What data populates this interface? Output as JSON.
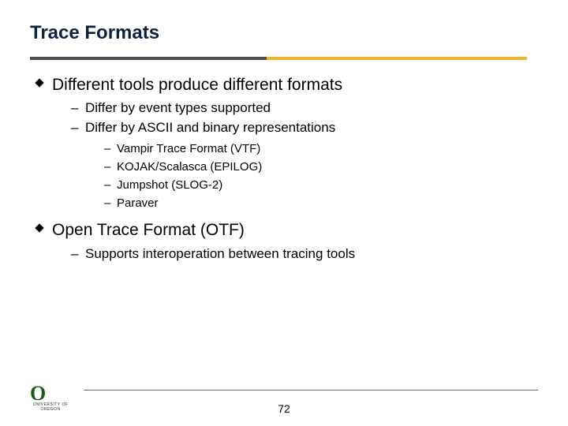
{
  "title": "Trace Formats",
  "bullets": [
    {
      "text": "Different tools produce different formats",
      "sub": [
        {
          "text": "Differ by event types supported"
        },
        {
          "text": "Differ by ASCII and binary representations",
          "sub": [
            {
              "text": "Vampir Trace Format (VTF)"
            },
            {
              "text": "KOJAK/Scalasca (EPILOG)"
            },
            {
              "text": "Jumpshot (SLOG-2)"
            },
            {
              "text": "Paraver"
            }
          ]
        }
      ]
    },
    {
      "text": "Open Trace Format (OTF)",
      "sub": [
        {
          "text": "Supports interoperation between tracing tools"
        }
      ]
    }
  ],
  "logo": {
    "glyph": "O",
    "label": "UNIVERSITY\nOF OREGON"
  },
  "page_number": "72",
  "colors": {
    "title": "#0b2341",
    "accent_gold": "#f0b429",
    "accent_dark": "#4c4c4c"
  }
}
